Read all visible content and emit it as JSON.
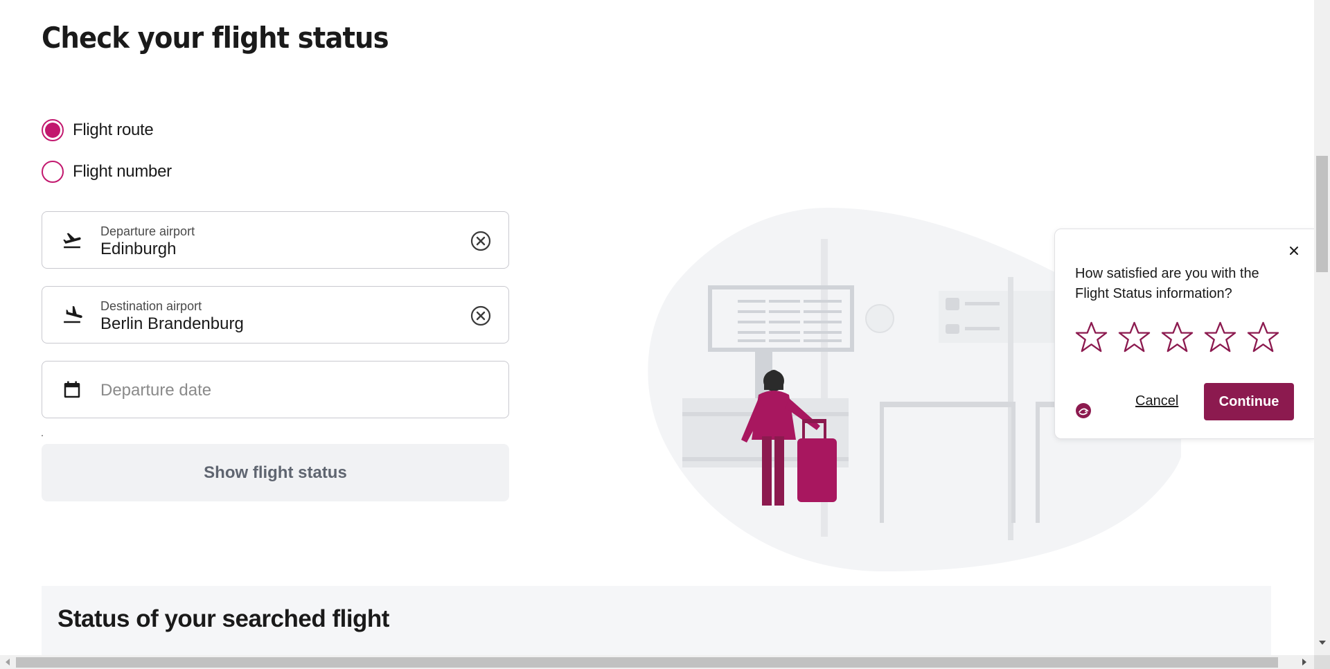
{
  "page": {
    "title": "Check your flight status"
  },
  "search_mode": {
    "options": [
      {
        "label": "Flight route",
        "selected": true
      },
      {
        "label": "Flight number",
        "selected": false
      }
    ]
  },
  "form": {
    "departure": {
      "label": "Departure airport",
      "value": "Edinburgh",
      "icon": "plane-takeoff-icon"
    },
    "destination": {
      "label": "Destination airport",
      "value": "Berlin Brandenburg",
      "icon": "plane-landing-icon"
    },
    "date": {
      "placeholder": "Departure date",
      "icon": "calendar-icon"
    },
    "submit_label": "Show flight status"
  },
  "status_section": {
    "title": "Status of your searched flight"
  },
  "feedback": {
    "question": "How satisfied are you with the Flight Status information?",
    "rating": 0,
    "max_rating": 5,
    "cancel_label": "Cancel",
    "continue_label": "Continue"
  },
  "colors": {
    "accent": "#c2186e",
    "button_dark": "#8c1a4f",
    "illustration_figure": "#a8175f",
    "illustration_bg": "#f3f4f6"
  }
}
